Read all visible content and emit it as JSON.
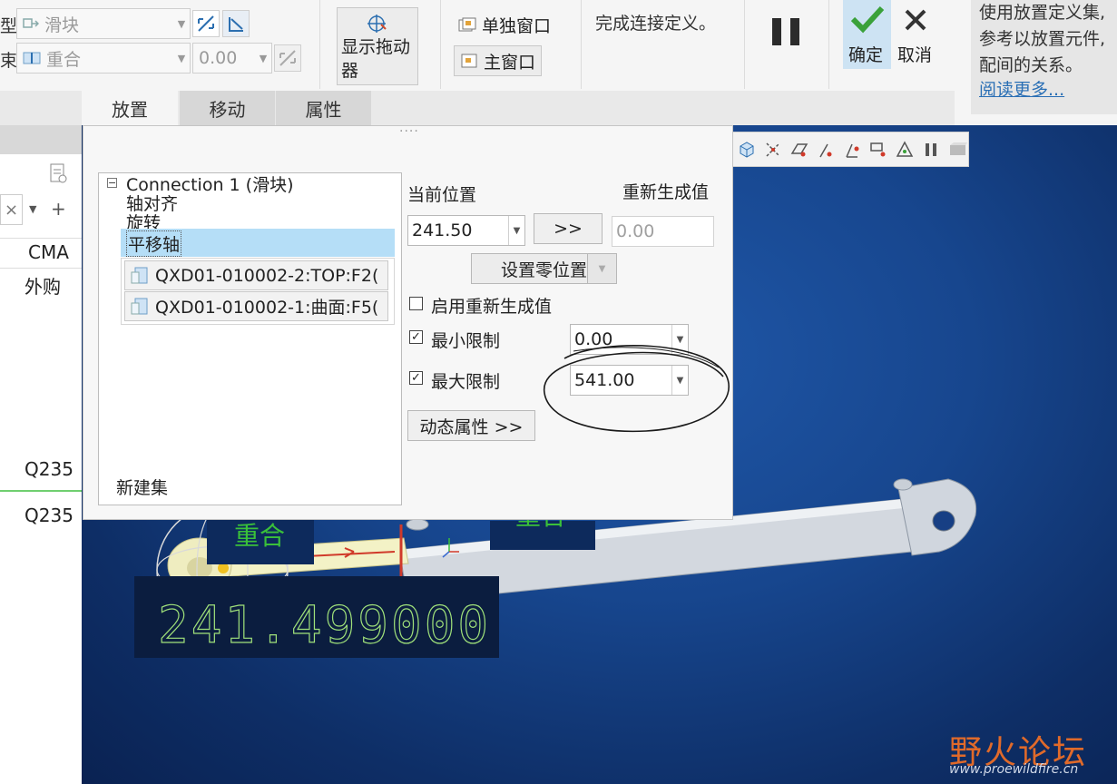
{
  "ribbon": {
    "type_label": "型:",
    "type_value": "滑块",
    "constraint_label": "束:",
    "constraint_value": "重合",
    "offset_value": "0.00",
    "show_dragger": "显示拖动\n器",
    "separate_window": "单独窗口",
    "main_window": "主窗口",
    "status_message": "完成连接定义。",
    "confirm_label": "确定",
    "cancel_label": "取消"
  },
  "help": {
    "text": "使用放置定义集,\n参考以放置元件,\n配间的关系。",
    "link": "阅读更多..."
  },
  "tabs": [
    {
      "label": "放置"
    },
    {
      "label": "移动"
    },
    {
      "label": "属性"
    }
  ],
  "left_panel": {
    "column_header": "CMA",
    "row1": "外购",
    "row2": "Q235",
    "row3": "Q235"
  },
  "placement": {
    "connection_title": "Connection  1 (滑块)",
    "constraints": [
      "轴对齐",
      "旋转",
      "平移轴"
    ],
    "refs": [
      "QXD01-010002-2:TOP:F2(",
      "QXD01-010002-1:曲面:F5("
    ],
    "new_set": "新建集",
    "current_position_label": "当前位置",
    "regen_value_label": "重新生成值",
    "current_position": "241.50",
    "copy_button": ">>",
    "regen_value": "0.00",
    "set_zero_button": "设置零位置",
    "enable_regen_label": "启用重新生成值",
    "enable_regen_checked": false,
    "min_limit_label": "最小限制",
    "min_limit_checked": true,
    "min_limit": "0.00",
    "max_limit_label": "最大限制",
    "max_limit_checked": true,
    "max_limit": "541.00",
    "dynamic_props_button": "动态属性 >>"
  },
  "viewport": {
    "label_coincident_1": "重合",
    "label_coincident_2": "重合",
    "dragger_readout": "241.499000"
  },
  "watermark": {
    "brand": "野火论坛",
    "url": "www.proewildfire.cn"
  },
  "colors": {
    "accent": "#2a6fb5",
    "confirm_green": "#3aa13a",
    "viewport_blue": "#17468e",
    "readout_green": "#9fe07a"
  }
}
